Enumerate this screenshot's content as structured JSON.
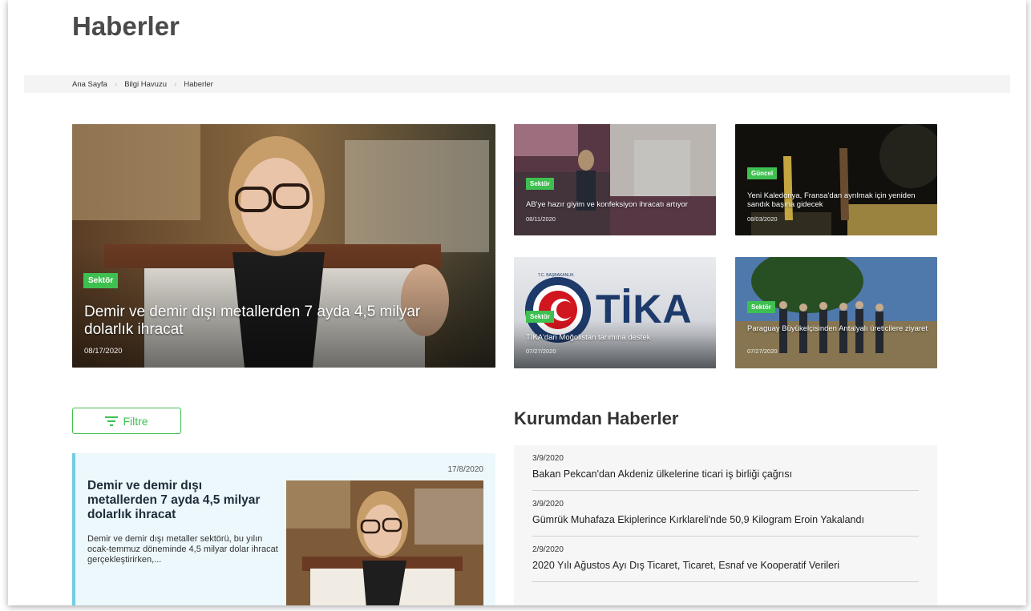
{
  "page": {
    "title": "Haberler"
  },
  "breadcrumb": {
    "items": [
      "Ana Sayfa",
      "Bilgi Havuzu",
      "Haberler"
    ]
  },
  "hero": {
    "tag": "Sektör",
    "title": "Demir ve demir dışı metallerden 7 ayda 4,5 milyar dolarlık ihracat",
    "date": "08/17/2020"
  },
  "cards": [
    {
      "tag": "Sektör",
      "title": "AB'ye hazır giyim ve konfeksiyon ihracatı artıyor",
      "date": "08/11/2020"
    },
    {
      "tag": "Güncel",
      "title": "Yeni Kaledonya, Fransa'dan ayrılmak için yeniden sandık başına gidecek",
      "date": "08/03/2020"
    },
    {
      "tag": "Sektör",
      "title": "TİKA'dan Moğolistan tarımına destek",
      "date": "07/27/2020",
      "logo_text": "TİKA",
      "seal_text": "T.C. BAŞBAKANLIK"
    },
    {
      "tag": "Sektör",
      "title": "Paraguay Büyükelçisinden Antalyalı üreticilere ziyaret",
      "date": "07/27/2020"
    }
  ],
  "filter": {
    "label": "Filtre",
    "icon": "filter-icon"
  },
  "featured": {
    "date": "17/8/2020",
    "title": "Demir ve demir dışı metallerden 7 ayda 4,5 milyar dolarlık ihracat",
    "description": "Demir ve demir dışı metaller sektörü, bu yılın ocak-temmuz döneminde 4,5 milyar dolar ihracat gerçekleştirirken,..."
  },
  "institution_news": {
    "title": "Kurumdan Haberler",
    "items": [
      {
        "date": "3/9/2020",
        "title": "Bakan Pekcan'dan Akdeniz ülkelerine ticari iş birliği çağrısı"
      },
      {
        "date": "3/9/2020",
        "title": "Gümrük Muhafaza Ekiplerince Kırklareli'nde 50,9 Kilogram Eroin Yakalandı"
      },
      {
        "date": "2/9/2020",
        "title": "2020 Yılı Ağustos Ayı Dış Ticaret, Ticaret, Esnaf ve Kooperatif Verileri"
      }
    ]
  },
  "colors": {
    "accent": "#3ec050",
    "featured_bg": "#edf8fc",
    "featured_border": "#72cde4"
  }
}
